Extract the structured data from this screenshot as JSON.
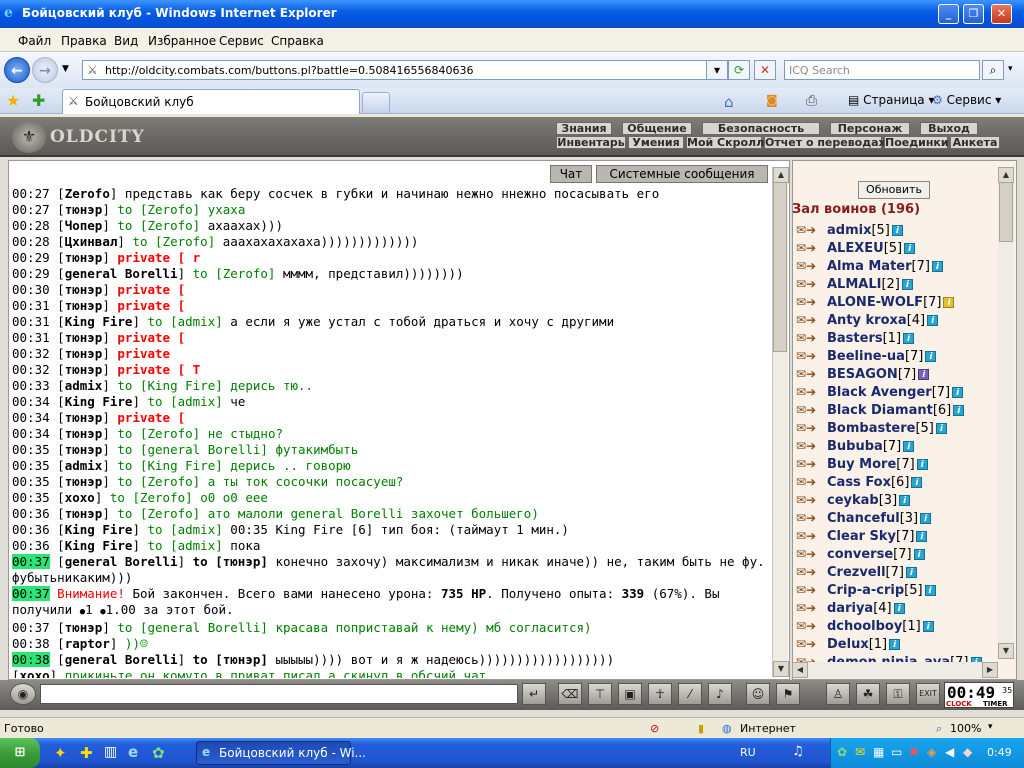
{
  "window": {
    "title": "Бойцовский клуб - Windows Internet Explorer"
  },
  "menu": {
    "items": [
      "Файл",
      "Правка",
      "Вид",
      "Избранное",
      "Сервис",
      "Справка"
    ]
  },
  "address": {
    "url": "http://oldcity.combats.com/buttons.pl?battle=0.508416556840636",
    "search_placeholder": "ICQ Search"
  },
  "tab": {
    "title": "Бойцовский клуб"
  },
  "commandbar": {
    "page": "Страница",
    "tools": "Сервис"
  },
  "game": {
    "logo": "OLDCITY",
    "nav_top": [
      "Знания",
      "Общение",
      "Безопасность",
      "Персонаж",
      "Выход"
    ],
    "nav_bottom": [
      "Инвентарь",
      "Умения",
      "Мой Скролл",
      "Отчет о переводах",
      "Поединки",
      "Анкета"
    ],
    "chat_tabs": [
      "Чат",
      "Системные сообщения"
    ],
    "refresh_label": "Обновить",
    "hall_title": "Зал воинов (196)",
    "clock": {
      "time": "00:49",
      "sec": "35",
      "label1": "CLOCK",
      "label2": "TIMER"
    }
  },
  "chat": [
    {
      "t": "00:27",
      "n": "Zerofo",
      "to": "",
      "p": false,
      "m": "представь как беру сосчек в губки и начинаю нежно ннежно посасывать его",
      "g": false
    },
    {
      "t": "00:27",
      "n": "тюнэр",
      "to": "to [Zerofo]",
      "p": false,
      "m": "ухаха",
      "g": true
    },
    {
      "t": "00:28",
      "n": "Чопер",
      "to": "to [Zerofo]",
      "p": false,
      "m": "ахаахах)))",
      "g": false
    },
    {
      "t": "00:28",
      "n": "Цхинвал",
      "to": "to [Zerofo]",
      "p": false,
      "m": "ааахахахахаха)))))))))))))",
      "g": false
    },
    {
      "t": "00:29",
      "n": "тюнэр",
      "to": "private [ r",
      "p": true,
      "m": "",
      "g": false
    },
    {
      "t": "00:29",
      "n": "general Borelli",
      "to": "to [Zerofo]",
      "p": false,
      "m": "мммм, представил))))))))",
      "g": false
    },
    {
      "t": "00:30",
      "n": "тюнэр",
      "to": "private [",
      "p": true,
      "m": "",
      "g": false
    },
    {
      "t": "00:31",
      "n": "тюнэр",
      "to": "private [",
      "p": true,
      "m": "",
      "g": false
    },
    {
      "t": "00:31",
      "n": "King Fire",
      "to": "to [admix]",
      "p": false,
      "m": "а если я уже устал с тобой драться и хочу с другими",
      "g": false
    },
    {
      "t": "00:31",
      "n": "тюнэр",
      "to": "private [",
      "p": true,
      "m": "",
      "g": false
    },
    {
      "t": "00:32",
      "n": "тюнэр",
      "to": "private",
      "p": true,
      "m": "",
      "g": false
    },
    {
      "t": "00:32",
      "n": "тюнэр",
      "to": "private [ T",
      "p": true,
      "m": "",
      "g": false
    },
    {
      "t": "00:33",
      "n": "admix",
      "to": "to [King Fire]",
      "p": false,
      "m": "дерись тю..",
      "g": true
    },
    {
      "t": "00:34",
      "n": "King Fire",
      "to": "to [admix]",
      "p": false,
      "m": "че",
      "g": false
    },
    {
      "t": "00:34",
      "n": "тюнэр",
      "to": "private [",
      "p": true,
      "m": "",
      "g": false
    },
    {
      "t": "00:34",
      "n": "тюнэр",
      "to": "to [Zerofo]",
      "p": false,
      "m": "не стыдно?",
      "g": true
    },
    {
      "t": "00:35",
      "n": "тюнэр",
      "to": "to [general Borelli]",
      "p": false,
      "m": "футакимбыть",
      "g": true
    },
    {
      "t": "00:35",
      "n": "admix",
      "to": "to [King Fire]",
      "p": false,
      "m": "дерись .. говорю",
      "g": true
    },
    {
      "t": "00:35",
      "n": "тюнэр",
      "to": "to [Zerofo]",
      "p": false,
      "m": "а ты ток сосочки посасуеш?",
      "g": true
    },
    {
      "t": "00:35",
      "n": "хохо",
      "to": "to [Zerofo]",
      "p": false,
      "m": "о0 о0 еее",
      "g": true
    },
    {
      "t": "00:36",
      "n": "тюнэр",
      "to": "to [Zerofo]",
      "p": false,
      "m": "ато малоли general Borelli захочет большего)",
      "g": true
    },
    {
      "t": "00:36",
      "n": "King Fire",
      "to": "to [admix]",
      "p": false,
      "m": "00:35 King Fire [6] тип боя: (таймаут 1 мин.)",
      "g": false
    },
    {
      "t": "00:36",
      "n": "King Fire",
      "to": "to [admix]",
      "p": false,
      "m": "пока",
      "g": false
    }
  ],
  "chat_special": {
    "l1": {
      "t": "00:37",
      "n": "general Borelli",
      "to": "to [тюнэр]",
      "m": "конечно захочу) максимализм и никак иначе)) не, таким быть не фу. фубытьникаким)))"
    },
    "l2": {
      "t": "00:37",
      "warn": "Внимание!",
      "m1": "Бой закончен. Всего вами нанесено урона:",
      "hp": "735 HP",
      "m2": ". Получено опыта:",
      "exp": "339",
      "m3": "(67%). Вы получили",
      "m4": "1",
      "m5": "1.00 за этот бой."
    },
    "l3": {
      "t": "00:37",
      "n": "тюнэр",
      "to": "to [general Borelli]",
      "m": "красава поприставай к нему) мб согласится)"
    },
    "l4": {
      "t": "00:38",
      "n": "raptor",
      "m": "))"
    },
    "l5": {
      "t": "00:38",
      "n": "general Borelli",
      "to": "to [тюнэр]",
      "m": "ыыыыы)))) вот и я ж надеюсь))))))))))))))))))"
    },
    "l6": {
      "t": "",
      "n": "хохо",
      "m": "прикиньте он комуто в приват писал а скинул в обсчий чат"
    }
  },
  "players": [
    {
      "n": "admix",
      "l": "[5]",
      "c": "b"
    },
    {
      "n": "ALEXEU",
      "l": "[5]",
      "c": "b"
    },
    {
      "n": "Alma Mater",
      "l": "[7]",
      "c": "b"
    },
    {
      "n": "ALMALI",
      "l": "[2]",
      "c": "b"
    },
    {
      "n": "ALONE-WOLF",
      "l": "[7]",
      "c": "y"
    },
    {
      "n": "Anty kroxa",
      "l": "[4]",
      "c": "b"
    },
    {
      "n": "Basters",
      "l": "[1]",
      "c": "b"
    },
    {
      "n": "Beeline-ua",
      "l": "[7]",
      "c": "b"
    },
    {
      "n": "BESAGON",
      "l": "[7]",
      "c": "p"
    },
    {
      "n": "Black Avenger",
      "l": "[7]",
      "c": "b"
    },
    {
      "n": "Black Diamant",
      "l": "[6]",
      "c": "b"
    },
    {
      "n": "Bombastere",
      "l": "[5]",
      "c": "b"
    },
    {
      "n": "Bububa",
      "l": "[7]",
      "c": "b"
    },
    {
      "n": "Buy More",
      "l": "[7]",
      "c": "b"
    },
    {
      "n": "Cass Fox",
      "l": "[6]",
      "c": "b"
    },
    {
      "n": "ceykab",
      "l": "[3]",
      "c": "b"
    },
    {
      "n": "Chanceful",
      "l": "[3]",
      "c": "b"
    },
    {
      "n": "Clear Sky",
      "l": "[7]",
      "c": "b"
    },
    {
      "n": "converse",
      "l": "[7]",
      "c": "b"
    },
    {
      "n": "Crezvell",
      "l": "[7]",
      "c": "b"
    },
    {
      "n": "Crip-a-crip",
      "l": "[5]",
      "c": "b"
    },
    {
      "n": "dariya",
      "l": "[4]",
      "c": "b"
    },
    {
      "n": "dchoolboy",
      "l": "[1]",
      "c": "b"
    },
    {
      "n": "Delux",
      "l": "[1]",
      "c": "b"
    },
    {
      "n": "demon ninja_ava",
      "l": "[7]",
      "c": "b"
    }
  ],
  "statusbar": {
    "left": "Готово",
    "zone": "Интернет",
    "zoom": "100%"
  },
  "taskbar": {
    "task": "Бойцовский клуб - Wi...",
    "lang": "RU",
    "time": "0:49"
  }
}
